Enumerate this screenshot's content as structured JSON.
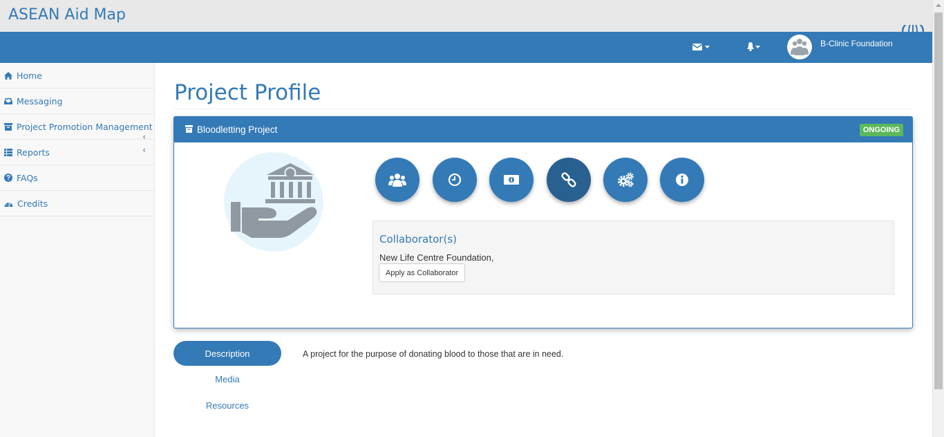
{
  "app": {
    "title": "ASEAN Aid Map"
  },
  "topnav": {
    "user_name": "B-Clinic Foundation"
  },
  "sidebar": {
    "items": [
      {
        "label": "Home"
      },
      {
        "label": "Messaging"
      },
      {
        "label": "Project Promotion Management"
      },
      {
        "label": "Reports"
      },
      {
        "label": "FAQs"
      },
      {
        "label": "Credits"
      }
    ]
  },
  "page": {
    "title": "Project Profile"
  },
  "project": {
    "name": "Bloodletting Project",
    "status": "ONGOING",
    "collaborators_heading": "Collaborator(s)",
    "collaborators_text": "New Life Centre Foundation,",
    "apply_label": "Apply as Collaborator"
  },
  "tabs": [
    {
      "label": "Description"
    },
    {
      "label": "Media"
    },
    {
      "label": "Resources"
    }
  ],
  "description": "A project for the purpose of donating blood to those that are in need.",
  "colors": {
    "primary": "#337ab7",
    "active": "#286090",
    "success": "#5cb85c"
  }
}
